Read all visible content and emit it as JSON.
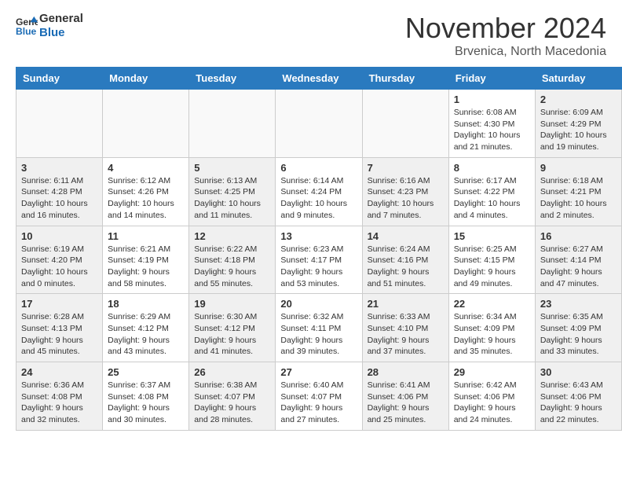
{
  "header": {
    "logo_line1": "General",
    "logo_line2": "Blue",
    "month_title": "November 2024",
    "location": "Brvenica, North Macedonia"
  },
  "calendar": {
    "days_of_week": [
      "Sunday",
      "Monday",
      "Tuesday",
      "Wednesday",
      "Thursday",
      "Friday",
      "Saturday"
    ],
    "weeks": [
      [
        {
          "day": "",
          "info": "",
          "empty": true
        },
        {
          "day": "",
          "info": "",
          "empty": true
        },
        {
          "day": "",
          "info": "",
          "empty": true
        },
        {
          "day": "",
          "info": "",
          "empty": true
        },
        {
          "day": "",
          "info": "",
          "empty": true
        },
        {
          "day": "1",
          "info": "Sunrise: 6:08 AM\nSunset: 4:30 PM\nDaylight: 10 hours and 21 minutes."
        },
        {
          "day": "2",
          "info": "Sunrise: 6:09 AM\nSunset: 4:29 PM\nDaylight: 10 hours and 19 minutes."
        }
      ],
      [
        {
          "day": "3",
          "info": "Sunrise: 6:11 AM\nSunset: 4:28 PM\nDaylight: 10 hours and 16 minutes."
        },
        {
          "day": "4",
          "info": "Sunrise: 6:12 AM\nSunset: 4:26 PM\nDaylight: 10 hours and 14 minutes."
        },
        {
          "day": "5",
          "info": "Sunrise: 6:13 AM\nSunset: 4:25 PM\nDaylight: 10 hours and 11 minutes."
        },
        {
          "day": "6",
          "info": "Sunrise: 6:14 AM\nSunset: 4:24 PM\nDaylight: 10 hours and 9 minutes."
        },
        {
          "day": "7",
          "info": "Sunrise: 6:16 AM\nSunset: 4:23 PM\nDaylight: 10 hours and 7 minutes."
        },
        {
          "day": "8",
          "info": "Sunrise: 6:17 AM\nSunset: 4:22 PM\nDaylight: 10 hours and 4 minutes."
        },
        {
          "day": "9",
          "info": "Sunrise: 6:18 AM\nSunset: 4:21 PM\nDaylight: 10 hours and 2 minutes."
        }
      ],
      [
        {
          "day": "10",
          "info": "Sunrise: 6:19 AM\nSunset: 4:20 PM\nDaylight: 10 hours and 0 minutes."
        },
        {
          "day": "11",
          "info": "Sunrise: 6:21 AM\nSunset: 4:19 PM\nDaylight: 9 hours and 58 minutes."
        },
        {
          "day": "12",
          "info": "Sunrise: 6:22 AM\nSunset: 4:18 PM\nDaylight: 9 hours and 55 minutes."
        },
        {
          "day": "13",
          "info": "Sunrise: 6:23 AM\nSunset: 4:17 PM\nDaylight: 9 hours and 53 minutes."
        },
        {
          "day": "14",
          "info": "Sunrise: 6:24 AM\nSunset: 4:16 PM\nDaylight: 9 hours and 51 minutes."
        },
        {
          "day": "15",
          "info": "Sunrise: 6:25 AM\nSunset: 4:15 PM\nDaylight: 9 hours and 49 minutes."
        },
        {
          "day": "16",
          "info": "Sunrise: 6:27 AM\nSunset: 4:14 PM\nDaylight: 9 hours and 47 minutes."
        }
      ],
      [
        {
          "day": "17",
          "info": "Sunrise: 6:28 AM\nSunset: 4:13 PM\nDaylight: 9 hours and 45 minutes."
        },
        {
          "day": "18",
          "info": "Sunrise: 6:29 AM\nSunset: 4:12 PM\nDaylight: 9 hours and 43 minutes."
        },
        {
          "day": "19",
          "info": "Sunrise: 6:30 AM\nSunset: 4:12 PM\nDaylight: 9 hours and 41 minutes."
        },
        {
          "day": "20",
          "info": "Sunrise: 6:32 AM\nSunset: 4:11 PM\nDaylight: 9 hours and 39 minutes."
        },
        {
          "day": "21",
          "info": "Sunrise: 6:33 AM\nSunset: 4:10 PM\nDaylight: 9 hours and 37 minutes."
        },
        {
          "day": "22",
          "info": "Sunrise: 6:34 AM\nSunset: 4:09 PM\nDaylight: 9 hours and 35 minutes."
        },
        {
          "day": "23",
          "info": "Sunrise: 6:35 AM\nSunset: 4:09 PM\nDaylight: 9 hours and 33 minutes."
        }
      ],
      [
        {
          "day": "24",
          "info": "Sunrise: 6:36 AM\nSunset: 4:08 PM\nDaylight: 9 hours and 32 minutes."
        },
        {
          "day": "25",
          "info": "Sunrise: 6:37 AM\nSunset: 4:08 PM\nDaylight: 9 hours and 30 minutes."
        },
        {
          "day": "26",
          "info": "Sunrise: 6:38 AM\nSunset: 4:07 PM\nDaylight: 9 hours and 28 minutes."
        },
        {
          "day": "27",
          "info": "Sunrise: 6:40 AM\nSunset: 4:07 PM\nDaylight: 9 hours and 27 minutes."
        },
        {
          "day": "28",
          "info": "Sunrise: 6:41 AM\nSunset: 4:06 PM\nDaylight: 9 hours and 25 minutes."
        },
        {
          "day": "29",
          "info": "Sunrise: 6:42 AM\nSunset: 4:06 PM\nDaylight: 9 hours and 24 minutes."
        },
        {
          "day": "30",
          "info": "Sunrise: 6:43 AM\nSunset: 4:06 PM\nDaylight: 9 hours and 22 minutes."
        }
      ]
    ]
  }
}
